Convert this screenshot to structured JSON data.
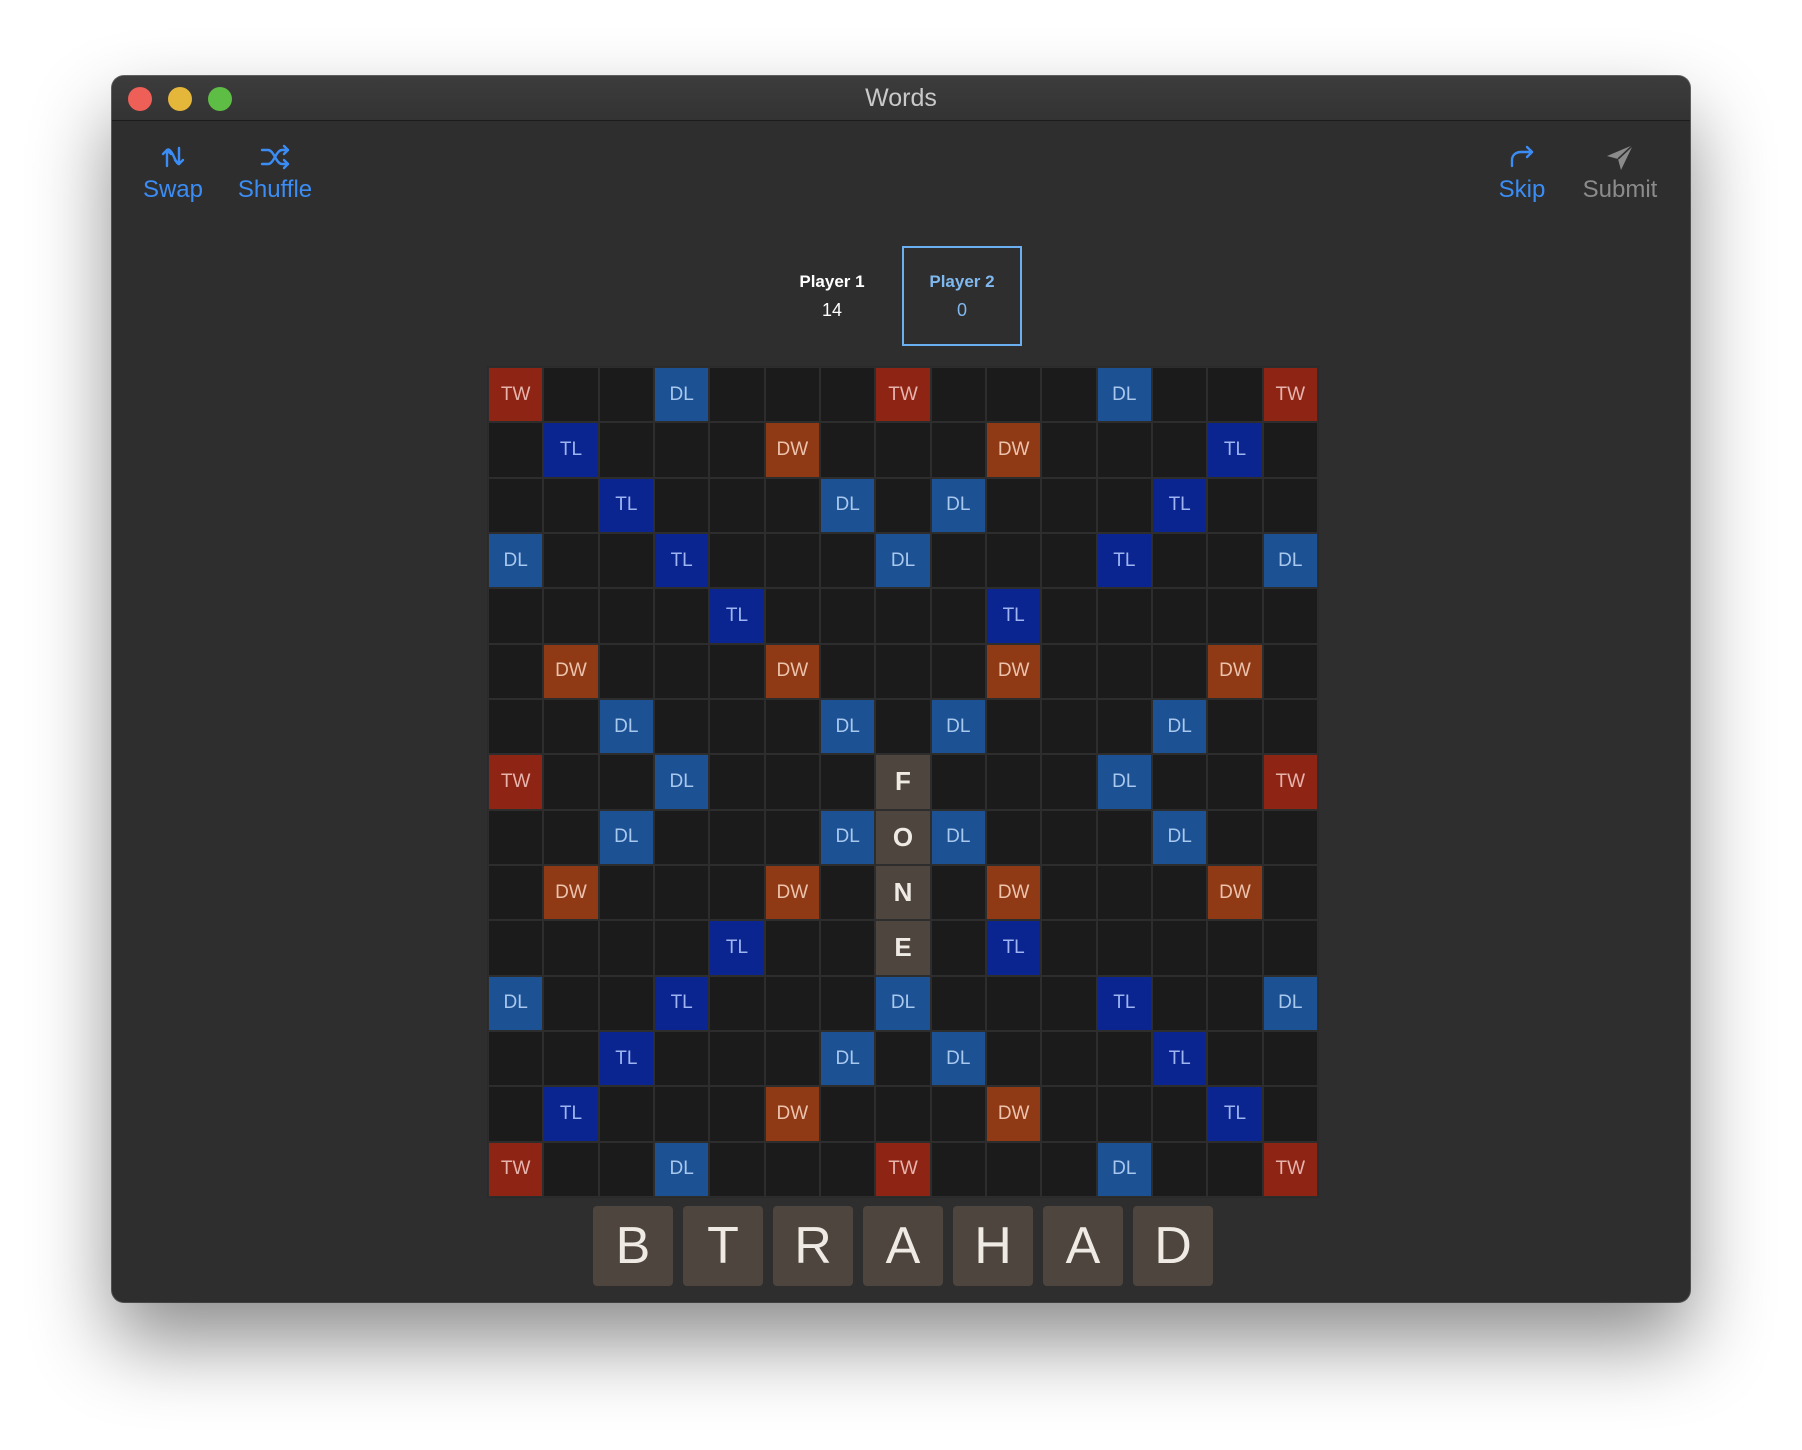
{
  "window": {
    "title": "Words"
  },
  "toolbar": {
    "swap": {
      "label": "Swap",
      "icon": "swap-icon"
    },
    "shuffle": {
      "label": "Shuffle",
      "icon": "shuffle-icon"
    },
    "skip": {
      "label": "Skip",
      "icon": "skip-icon"
    },
    "submit": {
      "label": "Submit",
      "icon": "paper-plane-icon",
      "enabled": false
    }
  },
  "scores": [
    {
      "name": "Player 1",
      "score": "14",
      "active": false
    },
    {
      "name": "Player 2",
      "score": "0",
      "active": true
    }
  ],
  "board": {
    "rows": [
      [
        "TW",
        "",
        "",
        "DL",
        "",
        "",
        "",
        "TW",
        "",
        "",
        "",
        "DL",
        "",
        "",
        "TW"
      ],
      [
        "",
        "TL",
        "",
        "",
        "",
        "DW",
        "",
        "",
        "",
        "DW",
        "",
        "",
        "",
        "TL",
        ""
      ],
      [
        "",
        "",
        "TL",
        "",
        "",
        "",
        "DL",
        "",
        "DL",
        "",
        "",
        "",
        "TL",
        "",
        ""
      ],
      [
        "DL",
        "",
        "",
        "TL",
        "",
        "",
        "",
        "DL",
        "",
        "",
        "",
        "TL",
        "",
        "",
        "DL"
      ],
      [
        "",
        "",
        "",
        "",
        "TL",
        "",
        "",
        "",
        "",
        "TL",
        "",
        "",
        "",
        "",
        ""
      ],
      [
        "",
        "DW",
        "",
        "",
        "",
        "DW",
        "",
        "",
        "",
        "DW",
        "",
        "",
        "",
        "DW",
        ""
      ],
      [
        "",
        "",
        "DL",
        "",
        "",
        "",
        "DL",
        "",
        "DL",
        "",
        "",
        "",
        "DL",
        "",
        ""
      ],
      [
        "TW",
        "",
        "",
        "DL",
        "",
        "",
        "",
        "@F",
        "",
        "",
        "",
        "DL",
        "",
        "",
        "TW"
      ],
      [
        "",
        "",
        "DL",
        "",
        "",
        "",
        "DL",
        "@O",
        "DL",
        "",
        "",
        "",
        "DL",
        "",
        ""
      ],
      [
        "",
        "DW",
        "",
        "",
        "",
        "DW",
        "",
        "@N",
        "",
        "DW",
        "",
        "",
        "",
        "DW",
        ""
      ],
      [
        "",
        "",
        "",
        "",
        "TL",
        "",
        "",
        "@E",
        "",
        "TL",
        "",
        "",
        "",
        "",
        ""
      ],
      [
        "DL",
        "",
        "",
        "TL",
        "",
        "",
        "",
        "DL",
        "",
        "",
        "",
        "TL",
        "",
        "",
        "DL"
      ],
      [
        "",
        "",
        "TL",
        "",
        "",
        "",
        "DL",
        "",
        "DL",
        "",
        "",
        "",
        "TL",
        "",
        ""
      ],
      [
        "",
        "TL",
        "",
        "",
        "",
        "DW",
        "",
        "",
        "",
        "DW",
        "",
        "",
        "",
        "TL",
        ""
      ],
      [
        "TW",
        "",
        "",
        "DL",
        "",
        "",
        "",
        "TW",
        "",
        "",
        "",
        "DL",
        "",
        "",
        "TW"
      ]
    ]
  },
  "rack": [
    "B",
    "T",
    "R",
    "A",
    "H",
    "A",
    "D"
  ],
  "colors": {
    "accent": "#3b8df5",
    "TW": "#8e2414",
    "DW": "#8f3a14",
    "DL": "#1c5194",
    "TL": "#0b2590",
    "tile": "#4d453e"
  }
}
